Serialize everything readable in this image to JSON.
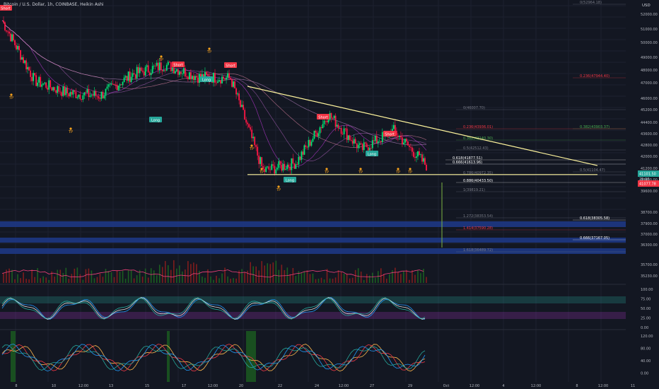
{
  "header": {
    "title": "Bitcoin / U.S. Dollar, 1h, COINBASE, Heikin Ashi"
  },
  "price_axis": {
    "currency": "USD",
    "ticks": [
      "52000.00",
      "51000.00",
      "50000.00",
      "49000.00",
      "48000.00",
      "47000.00",
      "46000.00",
      "45200.00",
      "44400.00",
      "43600.00",
      "42800.00",
      "42000.00",
      "41200.00",
      "40400.00",
      "39600.00",
      "38700.00",
      "37900.00",
      "37000.00",
      "36300.00",
      "35700.00",
      "35230.00"
    ],
    "last_price": "41101.50",
    "countdown": "25:00",
    "level_tag": "41077.78"
  },
  "osc1_axis": {
    "ticks": [
      "100.00",
      "75.00",
      "50.00",
      "25.00",
      "0.00"
    ]
  },
  "osc2_axis": {
    "ticks": [
      "120.00",
      "80.00",
      "40.00",
      "0.00"
    ]
  },
  "time_axis": {
    "ticks": [
      "8",
      "10",
      "12:00",
      "13",
      "15",
      "17",
      "12:00",
      "20",
      "22",
      "24",
      "12:00",
      "27",
      "29",
      "Oct",
      "12:00",
      "4",
      "12:00",
      "8",
      "12:00",
      "11"
    ]
  },
  "fib_labels": [
    {
      "text": "0(52964.18)",
      "color": "#787b86"
    },
    {
      "text": "0.236(47944.40)",
      "color": "#f23645"
    },
    {
      "text": "0.382(43903.37)",
      "color": "#4caf50"
    },
    {
      "text": "0(46007.70)",
      "color": "#787b86"
    },
    {
      "text": "0.236(43936.01)",
      "color": "#f23645"
    },
    {
      "text": "0.382(43140.30)",
      "color": "#4caf50"
    },
    {
      "text": "0.5(42512.43)",
      "color": "#787b86"
    },
    {
      "text": "0.618(41877.51)",
      "color": "#ffffff"
    },
    {
      "text": "0.666(41613.96)",
      "color": "#ffffff"
    },
    {
      "text": "0.5(41104.47)",
      "color": "#787b86"
    },
    {
      "text": "0.786(40972.35)",
      "color": "#787b86"
    },
    {
      "text": "0.886(40433.50)",
      "color": "#ffffff"
    },
    {
      "text": "1(39819.21)",
      "color": "#787b86"
    },
    {
      "text": "1.272(38353.54)",
      "color": "#787b86"
    },
    {
      "text": "0.618(38305.58)",
      "color": "#ffffff"
    },
    {
      "text": "1.414(37590.28)",
      "color": "#f23645"
    },
    {
      "text": "0.666(37167.05)",
      "color": "#ffffff"
    },
    {
      "text": "1.618(36489.72)",
      "color": "#787b86"
    }
  ],
  "signals": [
    {
      "text": "Short",
      "color": "#f23645"
    },
    {
      "text": "Short",
      "color": "#f23645"
    },
    {
      "text": "Short",
      "color": "#f23645"
    },
    {
      "text": "Short",
      "color": "#f23645"
    },
    {
      "text": "Short",
      "color": "#f23645"
    },
    {
      "text": "Long",
      "color": "#26a69a"
    },
    {
      "text": "Long",
      "color": "#26a69a"
    },
    {
      "text": "Long",
      "color": "#26a69a"
    },
    {
      "text": "Long",
      "color": "#26a69a"
    },
    {
      "text": "TP",
      "color": "#f7a21b"
    }
  ],
  "chart_data": {
    "type": "candlestick",
    "title": "Bitcoin / U.S. Dollar, 1h, COINBASE, Heikin Ashi",
    "ylim": [
      35000,
      53000
    ],
    "x": [
      "8",
      "10",
      "12:00",
      "13",
      "15",
      "17",
      "12:00",
      "20",
      "22",
      "24",
      "12:00",
      "27",
      "29",
      "30"
    ],
    "close": [
      51900,
      47400,
      46500,
      46300,
      47900,
      48600,
      47700,
      47600,
      40700,
      41300,
      44900,
      42300,
      43700,
      41100
    ],
    "trendlines": [
      {
        "name": "descending",
        "from": 47000,
        "to": 41100
      },
      {
        "name": "support",
        "from": 40430,
        "to": 40430
      }
    ],
    "osc1_range": [
      0,
      100
    ],
    "osc2_range": [
      -10,
      130
    ],
    "colors": {
      "up": "#00e676",
      "down": "#ff1744",
      "bg": "#131722",
      "zone": "#1e3a8a"
    }
  }
}
